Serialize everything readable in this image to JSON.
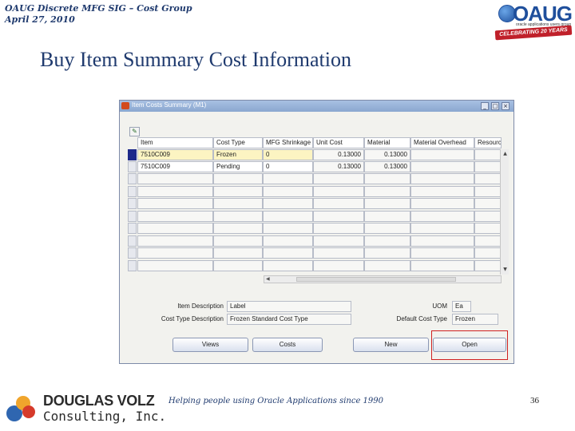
{
  "header": {
    "line1": "OAUG Discrete MFG SIG – Cost Group",
    "line2": "April 27, 2010"
  },
  "slide_title": "Buy Item Summary Cost Information",
  "oaug_logo": {
    "word": "OAUG",
    "sub": "oracle applications users group",
    "ribbon": "CELEBRATING 20 YEARS"
  },
  "window": {
    "title": "Item Costs Summary (M1)",
    "controls": [
      "_",
      "□",
      "×"
    ],
    "columns": [
      "Item",
      "Cost Type",
      "MFG Shrinkage",
      "Unit Cost",
      "Material",
      "Material Overhead",
      "Resource"
    ],
    "rows": [
      [
        "7510C009",
        "Frozen",
        "0",
        "0.13000",
        "0.13000",
        "",
        ""
      ],
      [
        "7510C009",
        "Pending",
        "0",
        "0.13000",
        "0.13000",
        "",
        ""
      ]
    ],
    "empty_rows": 8,
    "item_description_label": "Item Description",
    "item_description_value": "Label",
    "cost_type_description_label": "Cost Type Description",
    "cost_type_description_value": "Frozen Standard Cost Type",
    "uom_label": "UOM",
    "uom_value": "Ea",
    "default_cost_type_label": "Default Cost Type",
    "default_cost_type_value": "Frozen",
    "buttons": {
      "views": "Views",
      "costs": "Costs",
      "new": "New",
      "open": "Open"
    }
  },
  "footer": {
    "logo_name": "DOUGLAS VOLZ",
    "logo_sub": "Consulting, Inc.",
    "tagline": "Helping people using Oracle Applications since 1990",
    "page": "36"
  },
  "colors": {
    "title_blue": "#1f3a6e",
    "highlight_red": "#d02020",
    "current_row_yellow": "#fcf4c2",
    "row_indicator": "#1e2a8a"
  }
}
